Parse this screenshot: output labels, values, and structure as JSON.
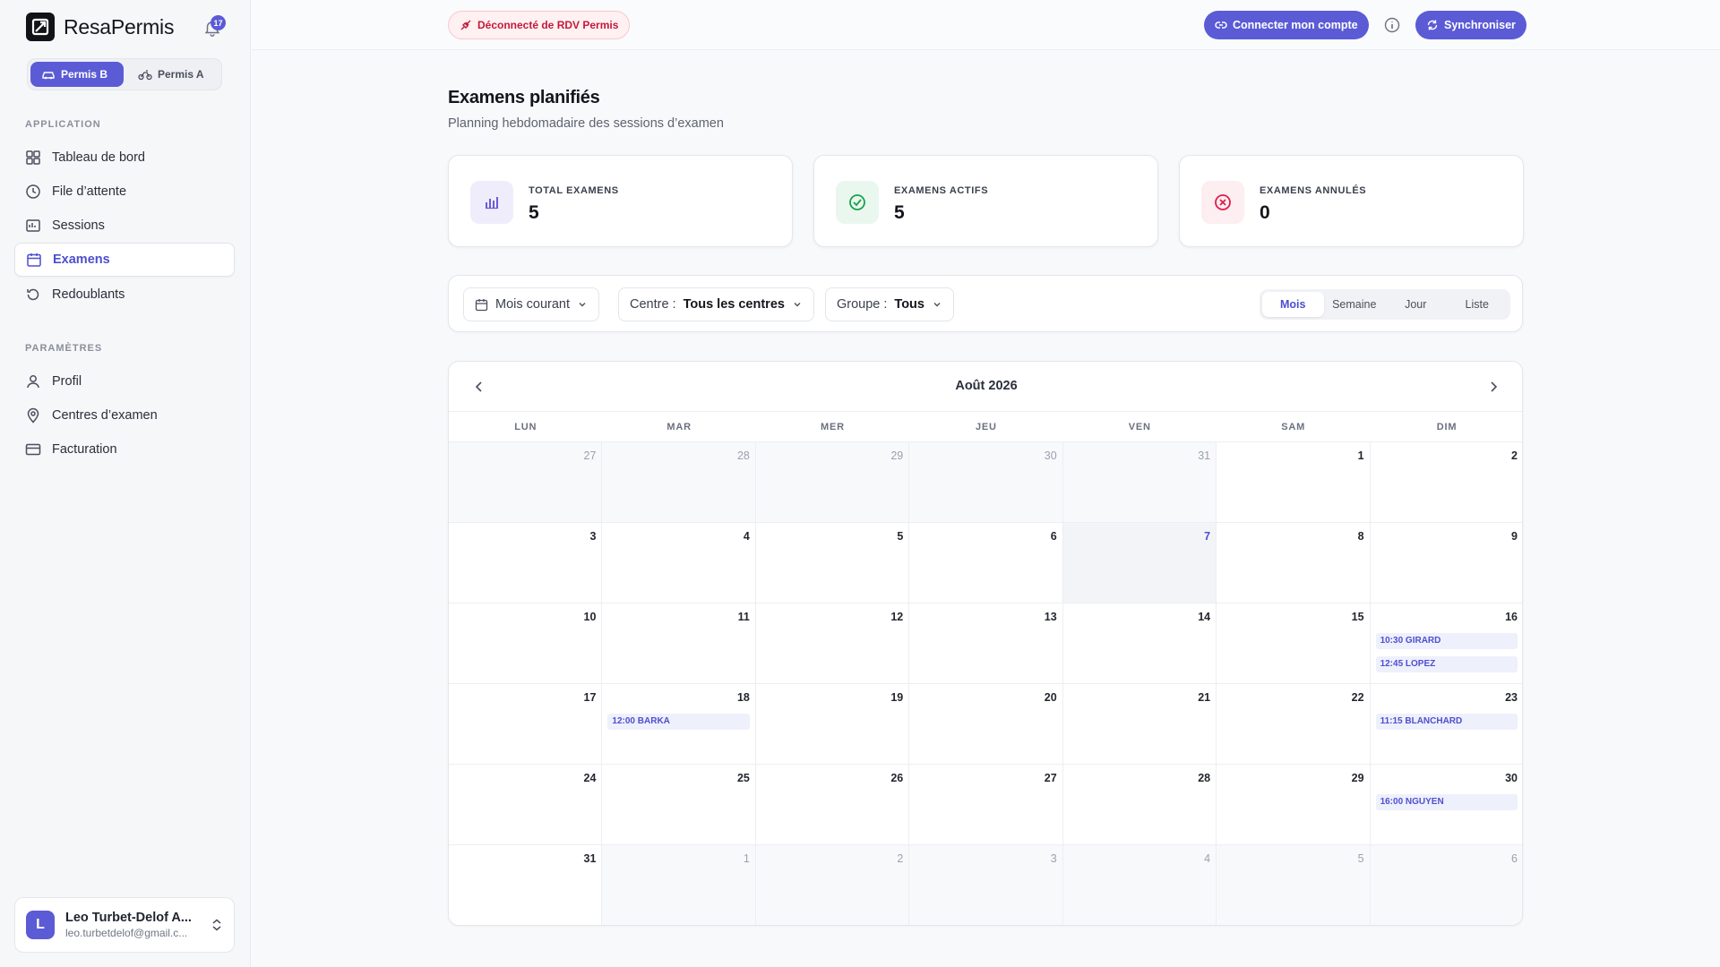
{
  "brand": {
    "name": "ResaPermis",
    "notifications": "17"
  },
  "permis": {
    "b_label": "Permis B",
    "a_label": "Permis A"
  },
  "nav": {
    "section_app": "APPLICATION",
    "section_params": "PARAMÈTRES",
    "items": [
      {
        "label": "Tableau de bord",
        "icon": "dashboard-icon"
      },
      {
        "label": "File d’attente",
        "icon": "clock-icon"
      },
      {
        "label": "Sessions",
        "icon": "sessions-icon"
      },
      {
        "label": "Examens",
        "icon": "calendar-icon",
        "active": true
      },
      {
        "label": "Redoublants",
        "icon": "history-icon"
      },
      {
        "label": "Profil",
        "icon": "user-icon"
      },
      {
        "label": "Centres d’examen",
        "icon": "map-pin-icon"
      },
      {
        "label": "Facturation",
        "icon": "credit-card-icon"
      }
    ]
  },
  "user": {
    "initial": "L",
    "name": "Leo Turbet-Delof A...",
    "email": "leo.turbetdelof@gmail.c..."
  },
  "topbar": {
    "status": "Déconnecté de RDV Permis",
    "connect": "Connecter mon compte",
    "sync": "Synchroniser"
  },
  "page": {
    "title": "Examens planifiés",
    "subtitle": "Planning hebdomadaire des sessions d’examen"
  },
  "stats": [
    {
      "label": "TOTAL EXAMENS",
      "value": "5",
      "color": "#6a5bd6"
    },
    {
      "label": "EXAMENS ACTIFS",
      "value": "5",
      "color": "#16a34a"
    },
    {
      "label": "EXAMENS ANNULÉS",
      "value": "0",
      "color": "#e11d48"
    }
  ],
  "filters": {
    "period": "Mois courant",
    "centre_label": "Centre :",
    "centre_value": "Tous les centres",
    "group_label": "Groupe :",
    "group_value": "Tous",
    "views": [
      "Mois",
      "Semaine",
      "Jour",
      "Liste"
    ],
    "active_view": "Mois"
  },
  "calendar": {
    "title": "Août 2026",
    "weekdays": [
      "LUN",
      "MAR",
      "MER",
      "JEU",
      "VEN",
      "SAM",
      "DIM"
    ],
    "weeks": [
      [
        {
          "d": "27",
          "o": true
        },
        {
          "d": "28",
          "o": true
        },
        {
          "d": "29",
          "o": true
        },
        {
          "d": "30",
          "o": true
        },
        {
          "d": "31",
          "o": true
        },
        {
          "d": "1"
        },
        {
          "d": "2"
        }
      ],
      [
        {
          "d": "3"
        },
        {
          "d": "4"
        },
        {
          "d": "5"
        },
        {
          "d": "6"
        },
        {
          "d": "7",
          "today": true
        },
        {
          "d": "8"
        },
        {
          "d": "9"
        }
      ],
      [
        {
          "d": "10"
        },
        {
          "d": "11"
        },
        {
          "d": "12"
        },
        {
          "d": "13"
        },
        {
          "d": "14"
        },
        {
          "d": "15"
        },
        {
          "d": "16",
          "events": [
            "10:30 GIRARD",
            "12:45 LOPEZ"
          ]
        }
      ],
      [
        {
          "d": "17"
        },
        {
          "d": "18",
          "events": [
            "12:00 BARKA"
          ]
        },
        {
          "d": "19"
        },
        {
          "d": "20"
        },
        {
          "d": "21"
        },
        {
          "d": "22"
        },
        {
          "d": "23",
          "events": [
            "11:15 BLANCHARD"
          ]
        }
      ],
      [
        {
          "d": "24"
        },
        {
          "d": "25"
        },
        {
          "d": "26"
        },
        {
          "d": "27"
        },
        {
          "d": "28"
        },
        {
          "d": "29"
        },
        {
          "d": "30",
          "events": [
            "16:00 NGUYEN"
          ]
        }
      ],
      [
        {
          "d": "31"
        },
        {
          "d": "1",
          "o": true
        },
        {
          "d": "2",
          "o": true
        },
        {
          "d": "3",
          "o": true
        },
        {
          "d": "4",
          "o": true
        },
        {
          "d": "5",
          "o": true
        },
        {
          "d": "6",
          "o": true
        }
      ]
    ]
  }
}
